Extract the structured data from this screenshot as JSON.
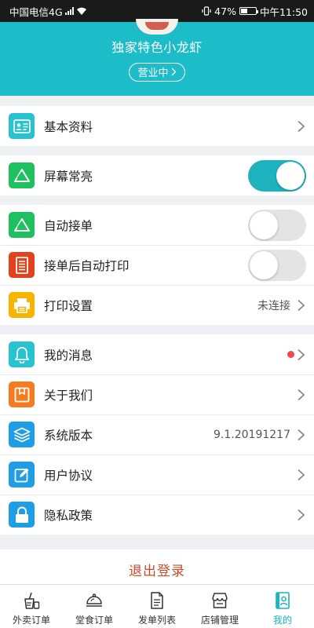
{
  "status_bar": {
    "carrier": "中国电信4G",
    "network_sup": "4G",
    "battery": "47%",
    "time": "中午11:50"
  },
  "header": {
    "store_name": "独家特色小龙虾",
    "status_label": "营业中",
    "status_chevron": "›"
  },
  "menu": {
    "basic_info": {
      "label": "基本资料",
      "icon": "id-card-icon",
      "color": "#27c3d0"
    },
    "screen_on": {
      "label": "屏幕常亮",
      "icon": "triangle-icon",
      "color": "#1fc05f",
      "enabled": true
    },
    "auto_accept": {
      "label": "自动接单",
      "icon": "triangle-icon",
      "color": "#1fc05f",
      "enabled": false
    },
    "auto_print": {
      "label": "接单后自动打印",
      "icon": "receipt-icon",
      "color": "#e2421c",
      "enabled": false
    },
    "print_settings": {
      "label": "打印设置",
      "value": "未连接",
      "icon": "printer-icon",
      "color": "#f7b500"
    },
    "messages": {
      "label": "我的消息",
      "icon": "bell-icon",
      "color": "#27c3d0",
      "has_unread": true
    },
    "about": {
      "label": "关于我们",
      "icon": "bookmark-icon",
      "color": "#f47c20"
    },
    "version": {
      "label": "系统版本",
      "value": "9.1.20191217",
      "icon": "layers-icon",
      "color": "#1f9ee6"
    },
    "agreement": {
      "label": "用户协议",
      "icon": "pen-icon",
      "color": "#1f9ee6"
    },
    "privacy": {
      "label": "隐私政策",
      "icon": "lock-icon",
      "color": "#1f9ee6"
    }
  },
  "logout_label": "退出登录",
  "tabs": [
    {
      "label": "外卖订单",
      "icon": "takeout-cup-icon",
      "active": false
    },
    {
      "label": "堂食订单",
      "icon": "dish-cover-icon",
      "active": false
    },
    {
      "label": "发单列表",
      "icon": "document-icon",
      "active": false
    },
    {
      "label": "店铺管理",
      "icon": "storefront-icon",
      "active": false
    },
    {
      "label": "我的",
      "icon": "profile-card-icon",
      "active": true
    }
  ],
  "colors": {
    "accent": "#1cbcc9",
    "logout": "#d24a28",
    "unread_dot": "#f04a4a"
  }
}
